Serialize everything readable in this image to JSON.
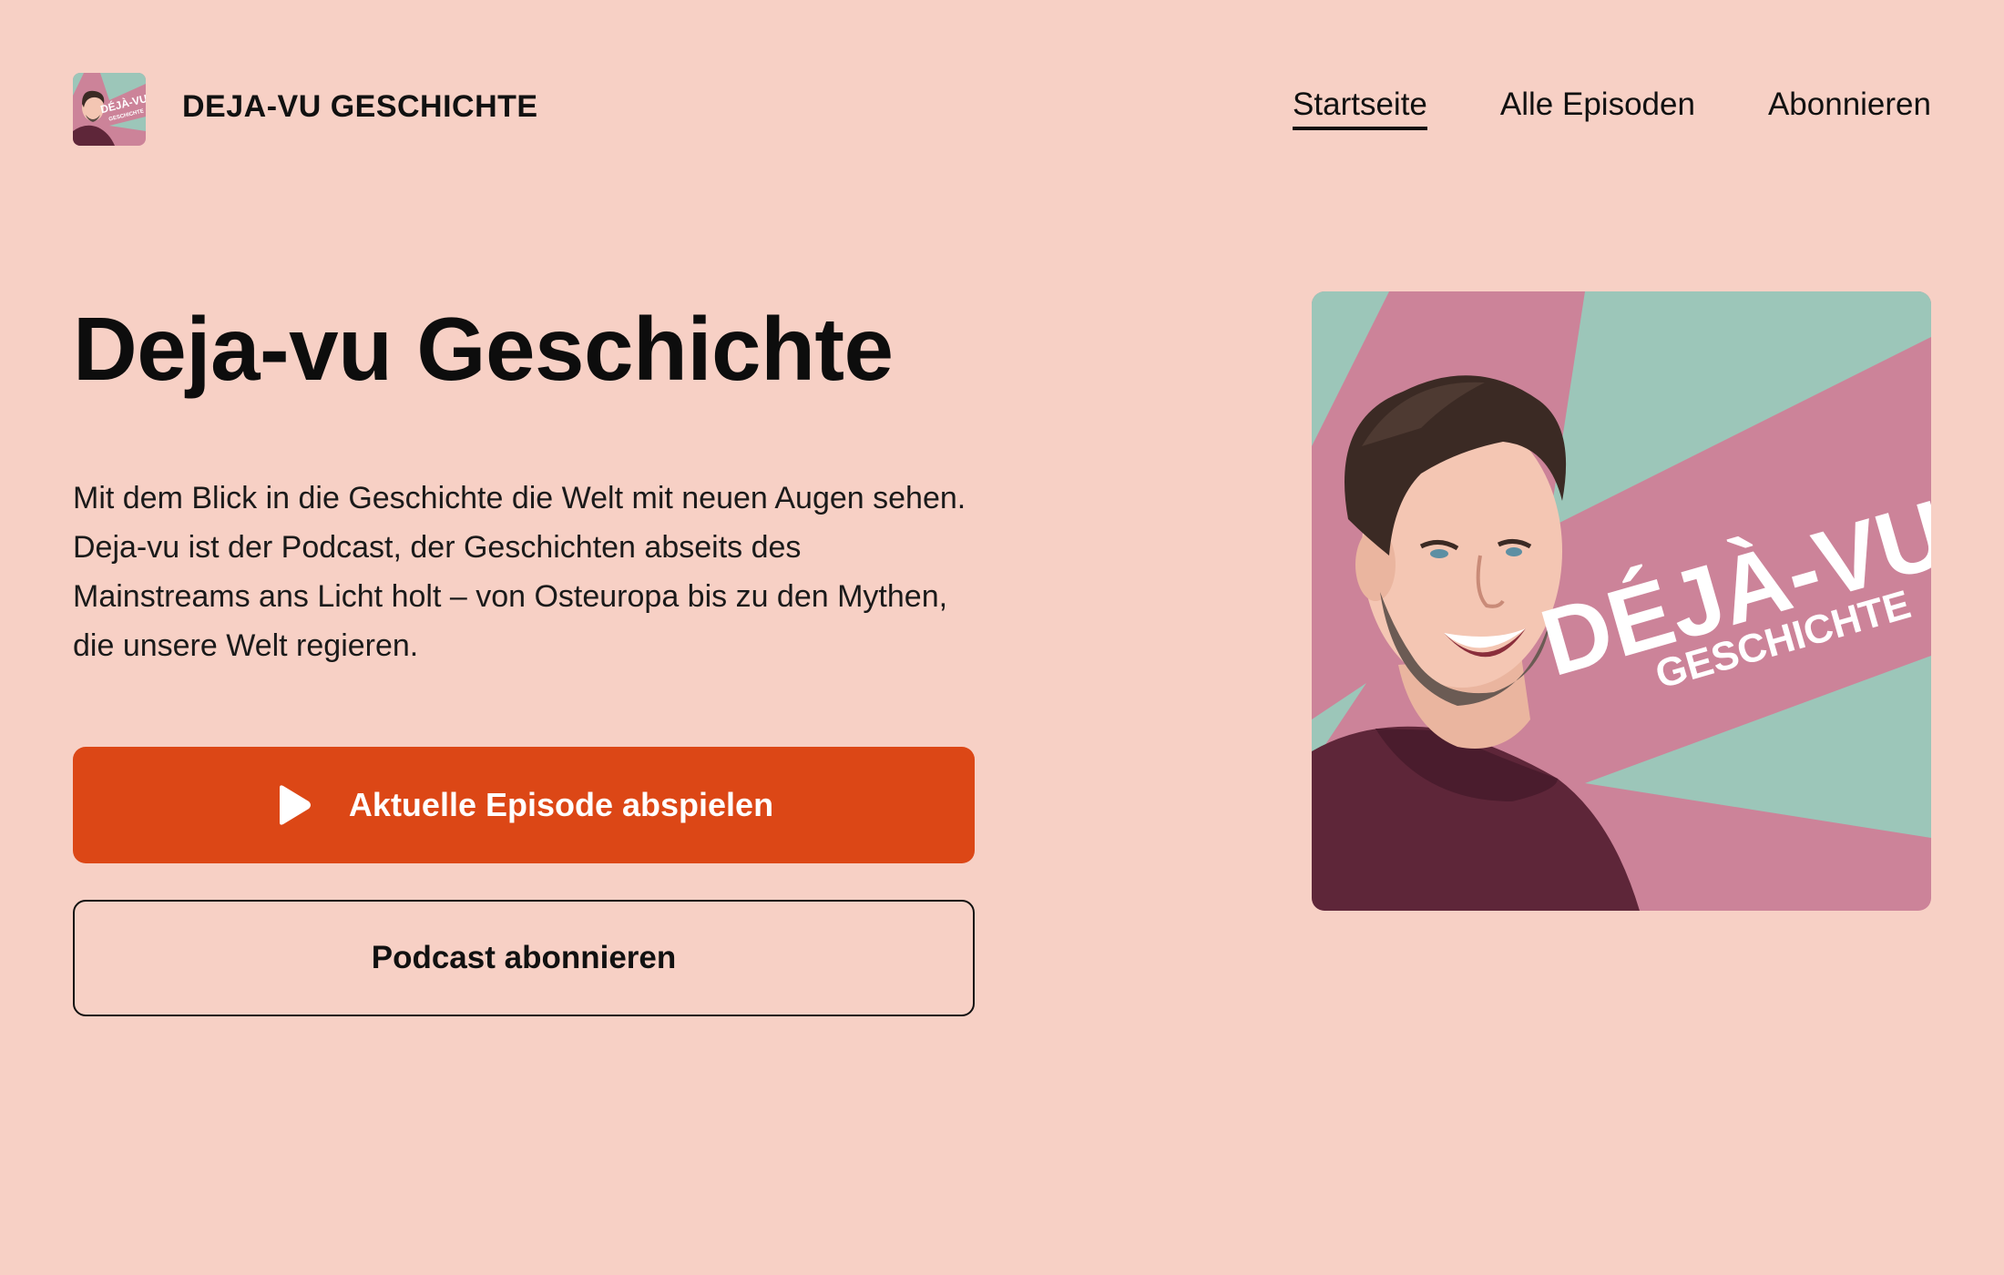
{
  "header": {
    "site_title": "DEJA-VU GESCHICHTE",
    "logo_icon": "podcast-cover-thumbnail-icon"
  },
  "nav": {
    "items": [
      {
        "label": "Startseite",
        "active": true
      },
      {
        "label": "Alle Episoden",
        "active": false
      },
      {
        "label": "Abonnieren",
        "active": false
      }
    ]
  },
  "hero": {
    "title": "Deja-vu Geschichte",
    "description": "Mit dem Blick in die Geschichte die Welt mit neuen Augen sehen. Deja-vu ist der Podcast, der Geschichten abseits des Mainstreams ans Licht holt – von Osteuropa bis zu den Mythen, die unsere Welt regieren.",
    "play_button_label": "Aktuelle Episode abspielen",
    "play_icon": "play-icon",
    "subscribe_button_label": "Podcast abonnieren"
  },
  "cover": {
    "title_big": "DÉJÀ-VU",
    "title_small": "GESCHICHTE",
    "thumb_big": "DÉJÀ-VU",
    "thumb_small": "GESCHICHTE"
  },
  "colors": {
    "background": "#f7d0c5",
    "accent": "#dc4716",
    "cover_mint": "#9cc6b9",
    "cover_pink": "#cc8399",
    "shirt": "#5e2639"
  }
}
